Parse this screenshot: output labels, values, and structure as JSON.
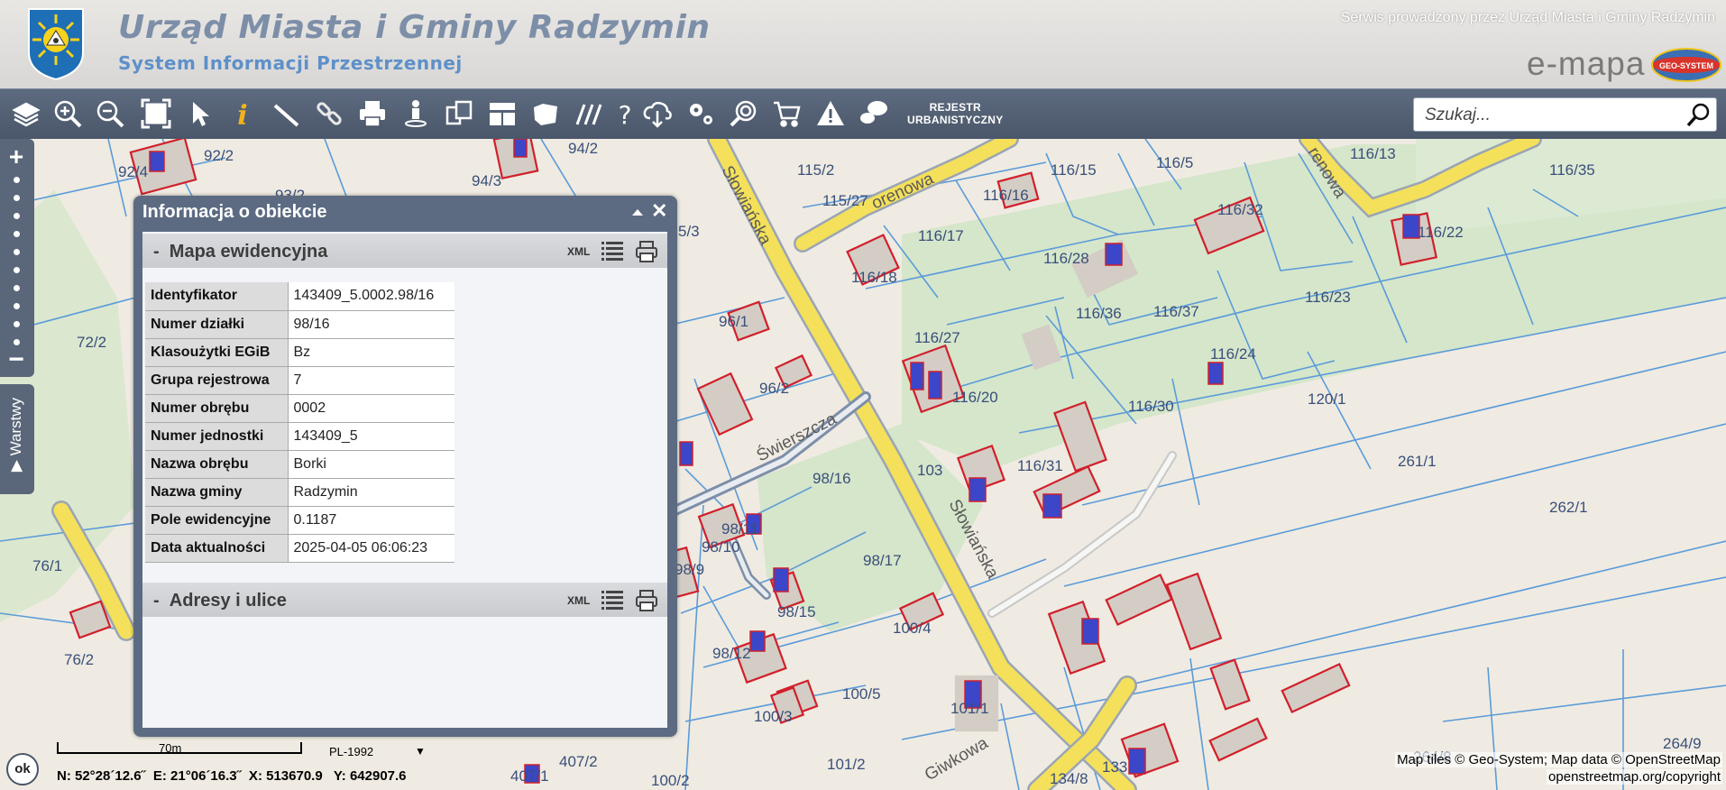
{
  "header": {
    "title": "Urząd Miasta i Gminy Radzymin",
    "subtitle": "System Informacji Przestrzennej",
    "service_note": "Serwis prowadzony przez Urząd Miasta i Gminy Radzymin",
    "brand": "e-mapa",
    "geo_logo_text": "GEO-SYSTEM"
  },
  "toolbar": {
    "icons": [
      "layers-icon",
      "zoom-in-icon",
      "zoom-out-icon",
      "zoom-extent-icon",
      "select-arrow-icon",
      "info-icon",
      "measure-ruler-icon",
      "link-icon",
      "print-icon",
      "street-view-icon",
      "compare-icon",
      "layout-icon",
      "map-shape-icon",
      "hatch-icon",
      "help-icon",
      "download-cloud-icon",
      "settings-icon",
      "zoom-search-icon",
      "cart-icon",
      "warning-icon",
      "chat-icon"
    ],
    "rejestr_line1": "REJESTR",
    "rejestr_line2": "URBANISTYCZNY",
    "search_placeholder": "Szukaj..."
  },
  "left_panel": {
    "zoom_plus": "+",
    "zoom_minus": "−",
    "layers_tab": "Warstwy"
  },
  "info_panel": {
    "title": "Informacja o obiekcie",
    "section1": {
      "title": "Mapa ewidencyjna",
      "xml": "XML"
    },
    "attributes": [
      {
        "key": "Identyfikator",
        "value": "143409_5.0002.98/16"
      },
      {
        "key": "Numer działki",
        "value": "98/16"
      },
      {
        "key": "Klasoużytki EGiB",
        "value": "Bz"
      },
      {
        "key": "Grupa rejestrowa",
        "value": "7"
      },
      {
        "key": "Numer obrębu",
        "value": "0002"
      },
      {
        "key": "Numer jednostki",
        "value": "143409_5"
      },
      {
        "key": "Nazwa obrębu",
        "value": "Borki"
      },
      {
        "key": "Nazwa gminy",
        "value": "Radzymin"
      },
      {
        "key": "Pole ewidencyjne",
        "value": "0.1187"
      },
      {
        "key": "Data aktualności",
        "value": "2025-04-05 06:06:23"
      }
    ],
    "section2": {
      "title": "Adresy i ulice",
      "xml": "XML"
    }
  },
  "map": {
    "streets": [
      "Słowiańska",
      "Świerszcza",
      "Słowiańska",
      "orenowa",
      "renowa",
      "Giwkowa"
    ],
    "parcels": [
      "92/4",
      "92/2",
      "94/2",
      "94/3",
      "93/2",
      "115/2",
      "115/27",
      "116/16",
      "116/15",
      "116/5",
      "116/13",
      "116/35",
      "116/32",
      "116/22",
      "116/17",
      "116/28",
      "116/18",
      "96/1",
      "116/36",
      "116/37",
      "116/23",
      "72/2",
      "5/3",
      "116/27",
      "116/24",
      "96/2",
      "116/20",
      "116/30",
      "120/1",
      "98/16",
      "103",
      "116/31",
      "261/1",
      "262/1",
      "98/11",
      "98/10",
      "76/1",
      "98/9",
      "98/17",
      "98/15",
      "100/4",
      "98/12",
      "76/2",
      "100/5",
      "101/1",
      "100/3",
      "264/9",
      "407/2",
      "407/1",
      "101/2",
      "100/2",
      "134/8",
      "133",
      "264/8"
    ]
  },
  "footer": {
    "ok": "ok",
    "scale": "70m",
    "projection": "PL-1992",
    "coords": "N: 52°28´12.6˝  E: 21°06´16.3˝  X: 513670.9   Y: 642907.6",
    "attribution1": "Map tiles © Geo-System; Map data © OpenStreetMap",
    "attribution2": "openstreetmap.org/copyright"
  }
}
